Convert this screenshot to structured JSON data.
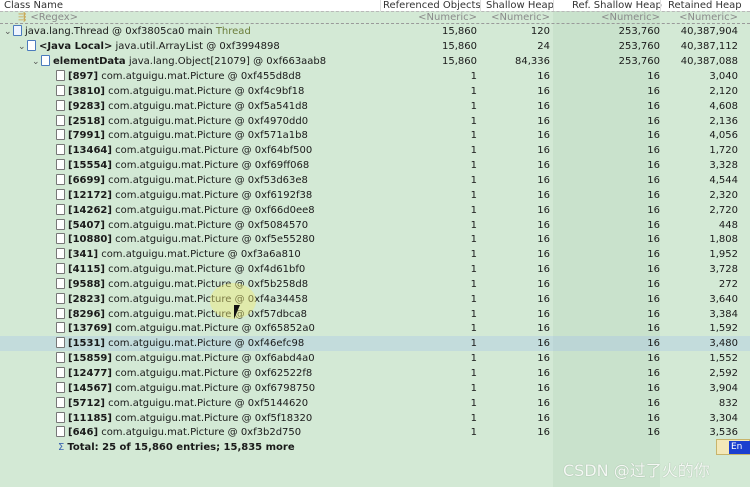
{
  "columns": [
    "Class Name",
    "Referenced Objects",
    "Shallow Heap",
    "Ref. Shallow Heap",
    "Retained Heap"
  ],
  "regex_row": {
    "name": "<Regex>",
    "filters": [
      "<Numeric>",
      "<Numeric>",
      "<Numeric>",
      "<Numeric>"
    ]
  },
  "tree": [
    {
      "prefix": "",
      "name": "java.lang.Thread @ 0xf3805ca0  main",
      "suffix": " Thread",
      "values": [
        "15,860",
        "120",
        "253,760",
        "40,387,904"
      ]
    },
    {
      "prefix": "<Java Local>",
      "name": " java.util.ArrayList @ 0xf3994898",
      "values": [
        "15,860",
        "24",
        "253,760",
        "40,387,112"
      ]
    },
    {
      "prefix": "elementData",
      "name": " java.lang.Object[21079] @ 0xf663aab8",
      "values": [
        "15,860",
        "84,336",
        "253,760",
        "40,387,088"
      ]
    }
  ],
  "items": [
    {
      "index": "[897]",
      "name": " com.atguigu.mat.Picture @ 0xf455d8d8",
      "values": [
        "1",
        "16",
        "16",
        "3,040"
      ]
    },
    {
      "index": "[3810]",
      "name": " com.atguigu.mat.Picture @ 0xf4c9bf18",
      "values": [
        "1",
        "16",
        "16",
        "2,120"
      ]
    },
    {
      "index": "[9283]",
      "name": " com.atguigu.mat.Picture @ 0xf5a541d8",
      "values": [
        "1",
        "16",
        "16",
        "4,608"
      ]
    },
    {
      "index": "[2518]",
      "name": " com.atguigu.mat.Picture @ 0xf4970dd0",
      "values": [
        "1",
        "16",
        "16",
        "2,136"
      ]
    },
    {
      "index": "[7991]",
      "name": " com.atguigu.mat.Picture @ 0xf571a1b8",
      "values": [
        "1",
        "16",
        "16",
        "4,056"
      ]
    },
    {
      "index": "[13464]",
      "name": " com.atguigu.mat.Picture @ 0xf64bf500",
      "values": [
        "1",
        "16",
        "16",
        "1,720"
      ]
    },
    {
      "index": "[15554]",
      "name": " com.atguigu.mat.Picture @ 0xf69ff068",
      "values": [
        "1",
        "16",
        "16",
        "3,328"
      ]
    },
    {
      "index": "[6699]",
      "name": " com.atguigu.mat.Picture @ 0xf53d63e8",
      "values": [
        "1",
        "16",
        "16",
        "4,544"
      ]
    },
    {
      "index": "[12172]",
      "name": " com.atguigu.mat.Picture @ 0xf6192f38",
      "values": [
        "1",
        "16",
        "16",
        "2,320"
      ]
    },
    {
      "index": "[14262]",
      "name": " com.atguigu.mat.Picture @ 0xf66d0ee8",
      "values": [
        "1",
        "16",
        "16",
        "2,720"
      ]
    },
    {
      "index": "[5407]",
      "name": " com.atguigu.mat.Picture @ 0xf5084570",
      "values": [
        "1",
        "16",
        "16",
        "448"
      ]
    },
    {
      "index": "[10880]",
      "name": " com.atguigu.mat.Picture @ 0xf5e55280",
      "values": [
        "1",
        "16",
        "16",
        "1,808"
      ]
    },
    {
      "index": "[341]",
      "name": " com.atguigu.mat.Picture @ 0xf3a6a810",
      "values": [
        "1",
        "16",
        "16",
        "1,952"
      ]
    },
    {
      "index": "[4115]",
      "name": " com.atguigu.mat.Picture @ 0xf4d61bf0",
      "values": [
        "1",
        "16",
        "16",
        "3,728"
      ]
    },
    {
      "index": "[9588]",
      "name": " com.atguigu.mat.Picture @ 0xf5b258d8",
      "values": [
        "1",
        "16",
        "16",
        "272"
      ]
    },
    {
      "index": "[2823]",
      "name": " com.atguigu.mat.Picture @ 0xf4a34458",
      "values": [
        "1",
        "16",
        "16",
        "3,640"
      ]
    },
    {
      "index": "[8296]",
      "name": " com.atguigu.mat.Picture @ 0xf57dbca8",
      "values": [
        "1",
        "16",
        "16",
        "3,384"
      ]
    },
    {
      "index": "[13769]",
      "name": " com.atguigu.mat.Picture @ 0xf65852a0",
      "values": [
        "1",
        "16",
        "16",
        "1,592"
      ]
    },
    {
      "index": "[1531]",
      "name": " com.atguigu.mat.Picture @ 0xf46efc98",
      "values": [
        "1",
        "16",
        "16",
        "3,480"
      ],
      "selected": true
    },
    {
      "index": "[15859]",
      "name": " com.atguigu.mat.Picture @ 0xf6abd4a0",
      "values": [
        "1",
        "16",
        "16",
        "1,552"
      ]
    },
    {
      "index": "[12477]",
      "name": " com.atguigu.mat.Picture @ 0xf62522f8",
      "values": [
        "1",
        "16",
        "16",
        "2,592"
      ]
    },
    {
      "index": "[14567]",
      "name": " com.atguigu.mat.Picture @ 0xf6798750",
      "values": [
        "1",
        "16",
        "16",
        "3,904"
      ]
    },
    {
      "index": "[5712]",
      "name": " com.atguigu.mat.Picture @ 0xf5144620",
      "values": [
        "1",
        "16",
        "16",
        "832"
      ]
    },
    {
      "index": "[11185]",
      "name": " com.atguigu.mat.Picture @ 0xf5f18320",
      "values": [
        "1",
        "16",
        "16",
        "3,304"
      ]
    },
    {
      "index": "[646]",
      "name": " com.atguigu.mat.Picture @ 0xf3b2d750",
      "values": [
        "1",
        "16",
        "16",
        "3,536"
      ]
    }
  ],
  "total": "Total: 25 of 15,860 entries; 15,835 more",
  "ime_label": "En",
  "watermark": "CSDN @过了火的你",
  "colors": {
    "background": "#d3e9d5",
    "selected_row": "#c3dcdc",
    "ref_column": "#c9e2cc"
  }
}
